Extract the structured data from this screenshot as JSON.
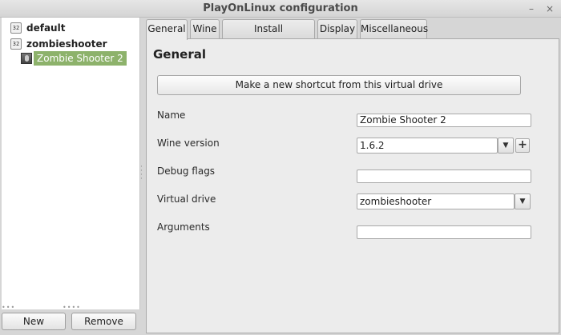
{
  "window": {
    "title": "PlayOnLinux configuration",
    "minimize_glyph": "–",
    "close_glyph": "×"
  },
  "tree": {
    "items": [
      {
        "label": "default",
        "icon": "32",
        "icon_name": "prefix-32bit-icon"
      },
      {
        "label": "zombieshooter",
        "icon": "32",
        "icon_name": "prefix-32bit-icon"
      }
    ],
    "child": {
      "label": "Zombie Shooter 2",
      "icon_name": "game-icon",
      "selected": true
    }
  },
  "left_buttons": {
    "new_label": "New",
    "remove_label": "Remove"
  },
  "tabs": [
    {
      "label": "General",
      "active": true
    },
    {
      "label": "Wine",
      "active": false
    },
    {
      "label": "Install components",
      "active": false
    },
    {
      "label": "Display",
      "active": false
    },
    {
      "label": "Miscellaneous",
      "active": false
    }
  ],
  "general": {
    "title": "General",
    "shortcut_button": "Make a new shortcut from this virtual drive",
    "name_label": "Name",
    "name_value": "Zombie Shooter 2",
    "wine_version_label": "Wine version",
    "wine_version_value": "1.6.2",
    "debug_flags_label": "Debug flags",
    "debug_flags_value": "",
    "virtual_drive_label": "Virtual drive",
    "virtual_drive_value": "zombieshooter",
    "arguments_label": "Arguments",
    "arguments_value": ""
  },
  "colors": {
    "selection": "#8db26b",
    "window_bg": "#d6d6d6",
    "panel_bg": "#ececec"
  }
}
